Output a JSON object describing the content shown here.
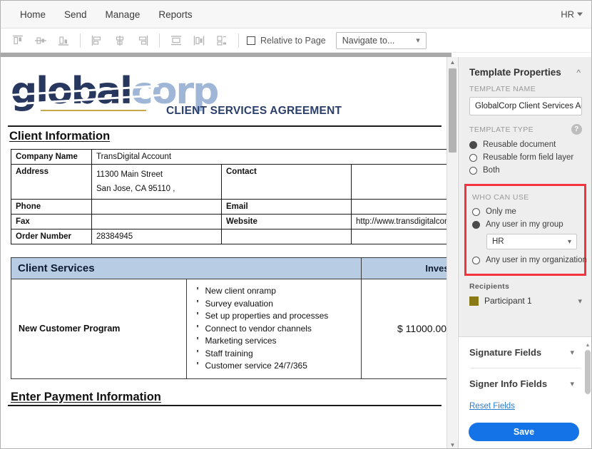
{
  "menubar": {
    "items": [
      {
        "label": "Home"
      },
      {
        "label": "Send"
      },
      {
        "label": "Manage"
      },
      {
        "label": "Reports"
      }
    ],
    "user": "HR"
  },
  "toolbar": {
    "icons": [
      "align-top-icon",
      "align-middle-horizontal-icon",
      "align-bottom-icon",
      "align-left-icon",
      "align-center-icon",
      "align-right-icon",
      "distribute-vertical-icon",
      "distribute-horizontal-icon",
      "match-size-icon"
    ],
    "relative_to_page_label": "Relative to Page",
    "relative_to_page_checked": false,
    "navigate_select_value": "Navigate to..."
  },
  "document": {
    "logo": {
      "part1": "global",
      "part2": "corp"
    },
    "agreement_title": "CLIENT SERVICES AGREEMENT",
    "client_information_heading": "Client Information",
    "client_info_rows": [
      {
        "label": "Company Name",
        "value": "TransDigital Account",
        "label2": "",
        "value2": ""
      },
      {
        "label": "Address",
        "value": "11300 Main Street",
        "value_line2": "San Jose, CA  95110  ,",
        "label2": "Contact",
        "value2": ""
      },
      {
        "label": "Phone",
        "value": "",
        "label2": "Email",
        "value2": ""
      },
      {
        "label": "Fax",
        "value": "",
        "label2": "Website",
        "value2": "http://www.transdigitalcorp.com"
      },
      {
        "label": "Order Number",
        "value": "28384945",
        "label2": "",
        "value2": ""
      }
    ],
    "services_header": "Client Services",
    "investment_header": "Investment",
    "program_name": "New Customer Program",
    "services": [
      "New client onramp",
      "Survey evaluation",
      "Set up properties and processes",
      "Connect to vendor channels",
      "Marketing services",
      "Staff training",
      "Customer service 24/7/365"
    ],
    "amount": "$ 11000.00",
    "payment_heading": "Enter Payment Information"
  },
  "panel": {
    "title": "Template Properties",
    "template_name_label": "Template Name",
    "template_name_value": "GlobalCorp Client Services Ag",
    "template_type_label": "Template Type",
    "template_type_options": [
      {
        "label": "Reusable document",
        "selected": true
      },
      {
        "label": "Reusable form field layer",
        "selected": false
      },
      {
        "label": "Both",
        "selected": false
      }
    ],
    "who_can_use_label": "Who can use",
    "who_can_use_options": [
      {
        "label": "Only me",
        "selected": false
      },
      {
        "label": "Any user in my group",
        "selected": true
      },
      {
        "label": "Any user in my organization",
        "selected": false
      }
    ],
    "group_value": "HR",
    "recipients_label": "Recipients",
    "recipient_name": "Participant 1",
    "recipient_color": "#8a7a16",
    "signature_fields_label": "Signature Fields",
    "signer_info_fields_label": "Signer Info Fields",
    "reset_fields_label": "Reset Fields",
    "save_label": "Save",
    "highlight_color": "#f5333f",
    "accent_color": "#1473e6"
  }
}
